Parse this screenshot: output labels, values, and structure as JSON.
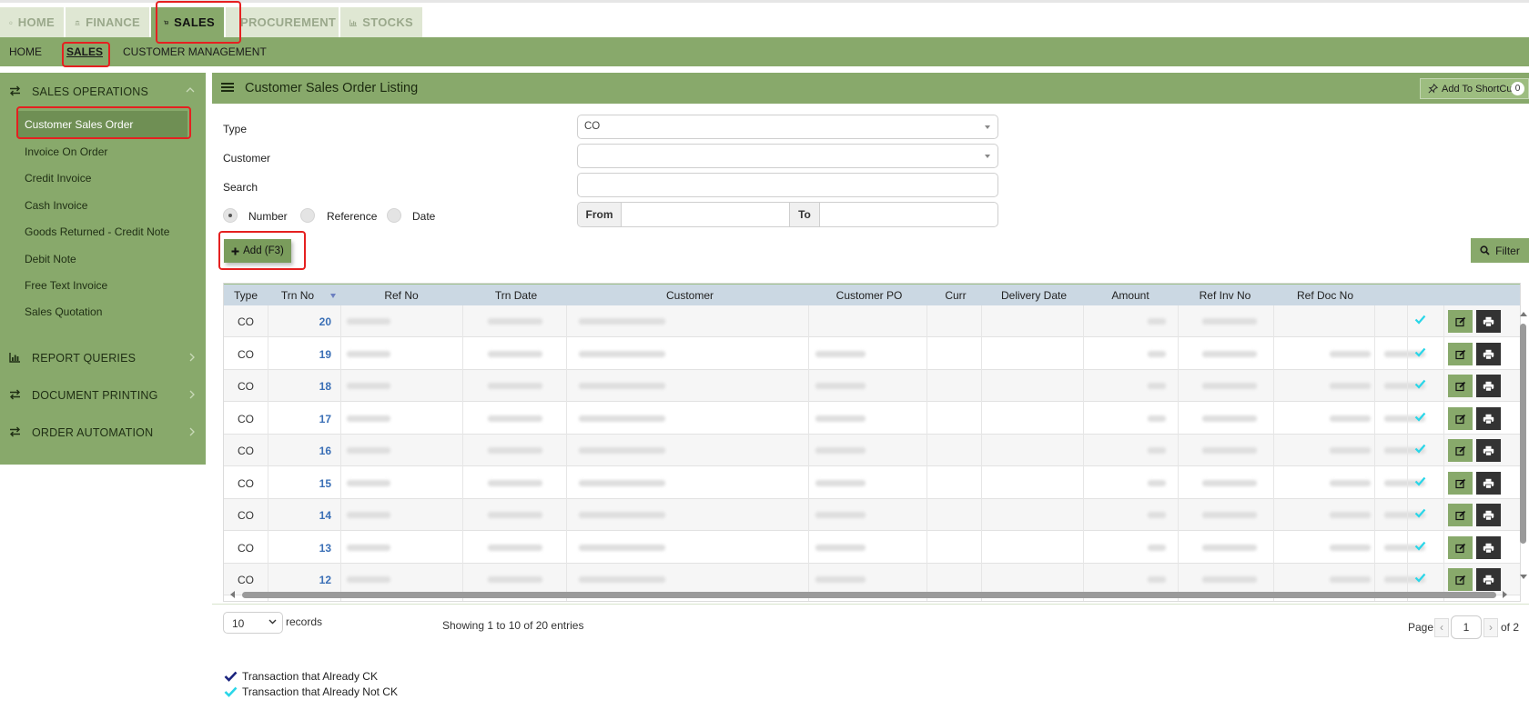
{
  "top_tabs": [
    {
      "label": "HOME",
      "icon": "home-icon",
      "active": false
    },
    {
      "label": "FINANCE",
      "icon": "bank-icon",
      "active": false
    },
    {
      "label": "SALES",
      "icon": "cart-icon",
      "active": true
    },
    {
      "label": "PROCUREMENT",
      "icon": "bullhorn-icon",
      "active": false
    },
    {
      "label": "STOCKS",
      "icon": "bar-chart-icon",
      "active": false
    }
  ],
  "sub_nav": [
    {
      "label": "HOME",
      "active": false
    },
    {
      "label": "SALES",
      "active": true
    },
    {
      "label": "CUSTOMER MANAGEMENT",
      "active": false
    }
  ],
  "sidebar": {
    "sales_operations": {
      "label": "SALES OPERATIONS",
      "items": [
        {
          "label": "Customer Sales Order",
          "active": true
        },
        {
          "label": "Invoice On Order"
        },
        {
          "label": "Credit Invoice"
        },
        {
          "label": "Cash Invoice"
        },
        {
          "label": "Goods Returned - Credit Note"
        },
        {
          "label": "Debit Note"
        },
        {
          "label": "Free Text Invoice"
        },
        {
          "label": "Sales Quotation"
        }
      ]
    },
    "report_queries": {
      "label": "REPORT QUERIES"
    },
    "document_printing": {
      "label": "DOCUMENT PRINTING"
    },
    "order_automation": {
      "label": "ORDER AUTOMATION"
    }
  },
  "panel": {
    "title": "Customer Sales Order Listing",
    "shortcut_label": "Add To ShortCut",
    "shortcut_count": "0"
  },
  "form": {
    "type_label": "Type",
    "type_value": "CO",
    "customer_label": "Customer",
    "customer_value": "",
    "search_label": "Search",
    "search_value": "",
    "radio_number": "Number",
    "radio_reference": "Reference",
    "radio_date": "Date",
    "selected_radio": "Number",
    "from_label": "From",
    "to_label": "To"
  },
  "buttons": {
    "add": "Add (F3)",
    "filter": "Filter"
  },
  "table": {
    "columns": [
      "Type",
      "Trn No",
      "Ref No",
      "Trn Date",
      "Customer",
      "Customer PO",
      "Curr",
      "Delivery Date",
      "Amount",
      "Ref Inv No",
      "Ref Doc No"
    ],
    "rows": [
      {
        "type": "CO",
        "trn_no": "20"
      },
      {
        "type": "CO",
        "trn_no": "19"
      },
      {
        "type": "CO",
        "trn_no": "18"
      },
      {
        "type": "CO",
        "trn_no": "17"
      },
      {
        "type": "CO",
        "trn_no": "16"
      },
      {
        "type": "CO",
        "trn_no": "15"
      },
      {
        "type": "CO",
        "trn_no": "14"
      },
      {
        "type": "CO",
        "trn_no": "13"
      },
      {
        "type": "CO",
        "trn_no": "12"
      }
    ]
  },
  "footer": {
    "page_size": "10",
    "records_label": "records",
    "showing_text": "Showing 1 to 10 of 20 entries",
    "page_label": "Page",
    "page_value": "1",
    "of_label": "of 2"
  },
  "legend": [
    {
      "text": "Transaction that Already CK",
      "color": "#1a237e"
    },
    {
      "text": "Transaction that Already Not CK",
      "color": "#29d6e8"
    }
  ],
  "colors": {
    "accent_green": "#88a96b",
    "link_blue": "#3a6fb6",
    "highlight_red": "#e52020"
  }
}
